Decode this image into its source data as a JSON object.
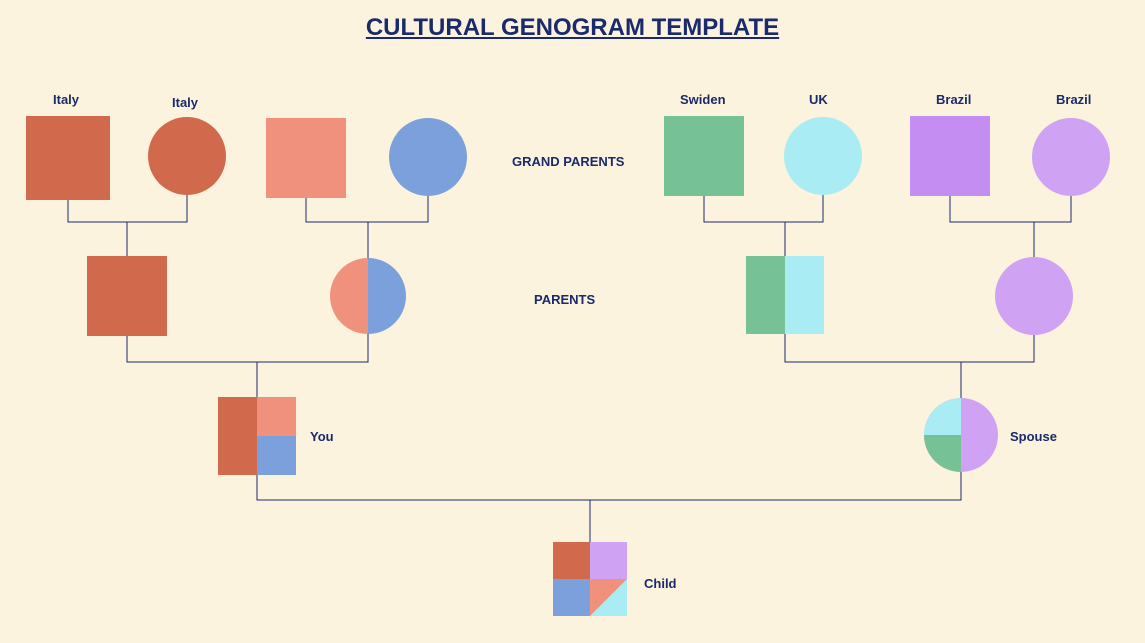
{
  "title": "CULTURAL GENOGRAM  TEMPLATE",
  "rows": {
    "grandparents": "GRAND PARENTS",
    "parents": "PARENTS"
  },
  "labels": {
    "gp1_m": "Italy",
    "gp1_f": "Italy",
    "gp3_m": "Swiden",
    "gp3_f": "UK",
    "gp4_m": "Brazil",
    "gp4_f": "Brazil",
    "you": "You",
    "spouse": "Spouse",
    "child": "Child"
  },
  "colors": {
    "italy": "#d1694d",
    "coral": "#f0917d",
    "blue": "#7ba0db",
    "sweden": "#77c196",
    "uk": "#a9ecf3",
    "brazil": "#c38df1",
    "brazil_light": "#d0a2f3",
    "line": "#1a2a6c"
  }
}
